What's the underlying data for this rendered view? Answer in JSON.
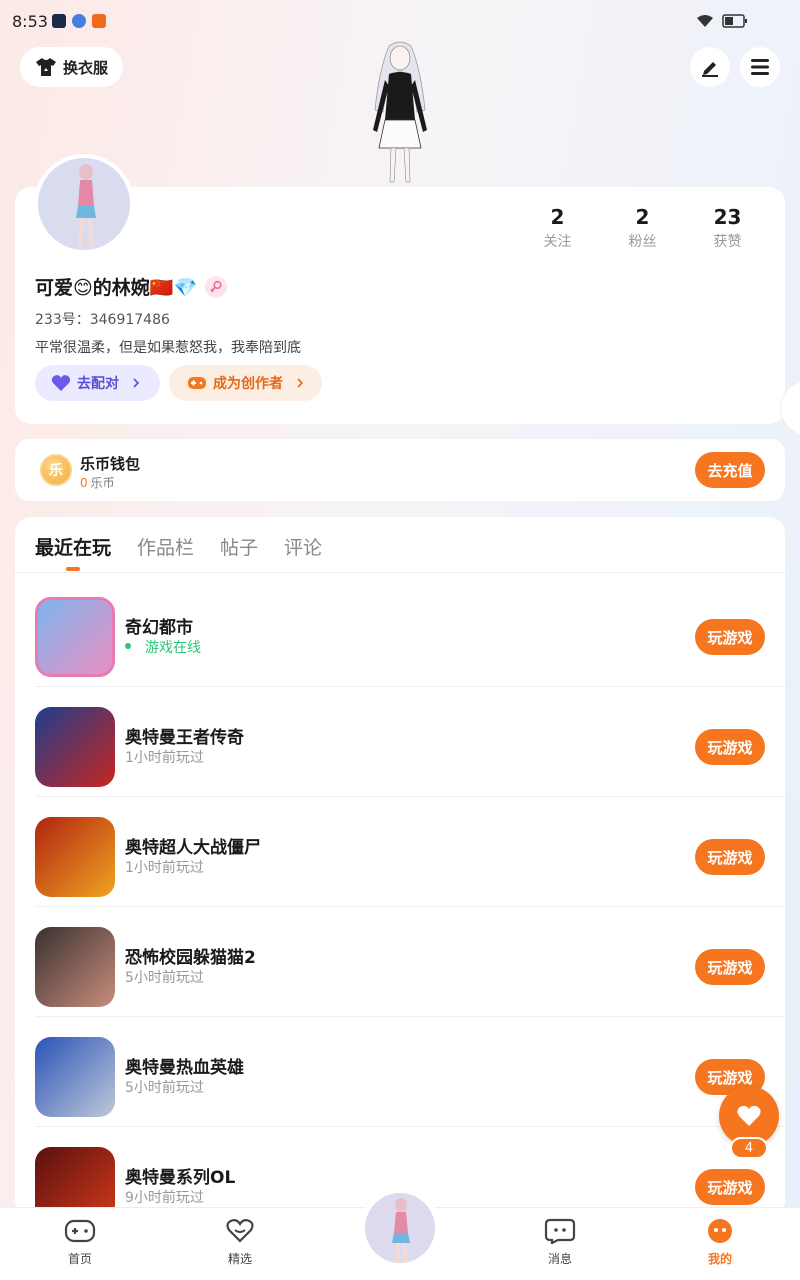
{
  "status_bar": {
    "time": "8:53"
  },
  "header": {
    "outfit_label": "换衣服"
  },
  "profile": {
    "nickname": "可爱😊的林婉🇨🇳💎",
    "uid": "233号：346917486",
    "bio": "平常很温柔，但是如果惹怒我，我奉陪到底",
    "stats": [
      {
        "value": "2",
        "label": "关注"
      },
      {
        "value": "2",
        "label": "粉丝"
      },
      {
        "value": "23",
        "label": "获赞"
      }
    ],
    "match_label": "去配对",
    "creator_label": "成为创作者"
  },
  "wallet": {
    "coin_glyph": "乐",
    "title": "乐币钱包",
    "amount": "0",
    "unit": "乐币",
    "recharge_label": "去充值"
  },
  "tabs": [
    "最近在玩",
    "作品栏",
    "帖子",
    "评论"
  ],
  "games": [
    {
      "title": "奇幻都市",
      "subtitle": "游戏在线",
      "online": true,
      "button": "玩游戏",
      "colors": [
        "#7fb3ef",
        "#e98fc0"
      ]
    },
    {
      "title": "奥特曼王者传奇",
      "subtitle": "1小时前玩过",
      "online": false,
      "button": "玩游戏",
      "colors": [
        "#1e3d8f",
        "#c8261f"
      ]
    },
    {
      "title": "奥特超人大战僵尸",
      "subtitle": "1小时前玩过",
      "online": false,
      "button": "玩游戏",
      "colors": [
        "#b0240f",
        "#f1a322"
      ]
    },
    {
      "title": "恐怖校园躲猫猫2",
      "subtitle": "5小时前玩过",
      "online": false,
      "button": "玩游戏",
      "colors": [
        "#3a3030",
        "#c98d7c"
      ]
    },
    {
      "title": "奥特曼热血英雄",
      "subtitle": "5小时前玩过",
      "online": false,
      "button": "玩游戏",
      "colors": [
        "#2a53b8",
        "#c0c8d8"
      ]
    },
    {
      "title": "奥特曼系列OL",
      "subtitle": "9小时前玩过",
      "online": false,
      "button": "玩游戏",
      "colors": [
        "#5a1010",
        "#d43a1a"
      ]
    }
  ],
  "likes_count": "4",
  "bottom_nav": [
    {
      "label": "首页",
      "icon": "gamepad-icon"
    },
    {
      "label": "精选",
      "icon": "heart-outline-icon"
    },
    {
      "label": "消息",
      "icon": "chat-icon"
    },
    {
      "label": "我的",
      "icon": "profile-face-icon"
    }
  ],
  "colors": {
    "accent": "#f6751f",
    "online": "#2fc477",
    "match": "#5a4fd6"
  }
}
